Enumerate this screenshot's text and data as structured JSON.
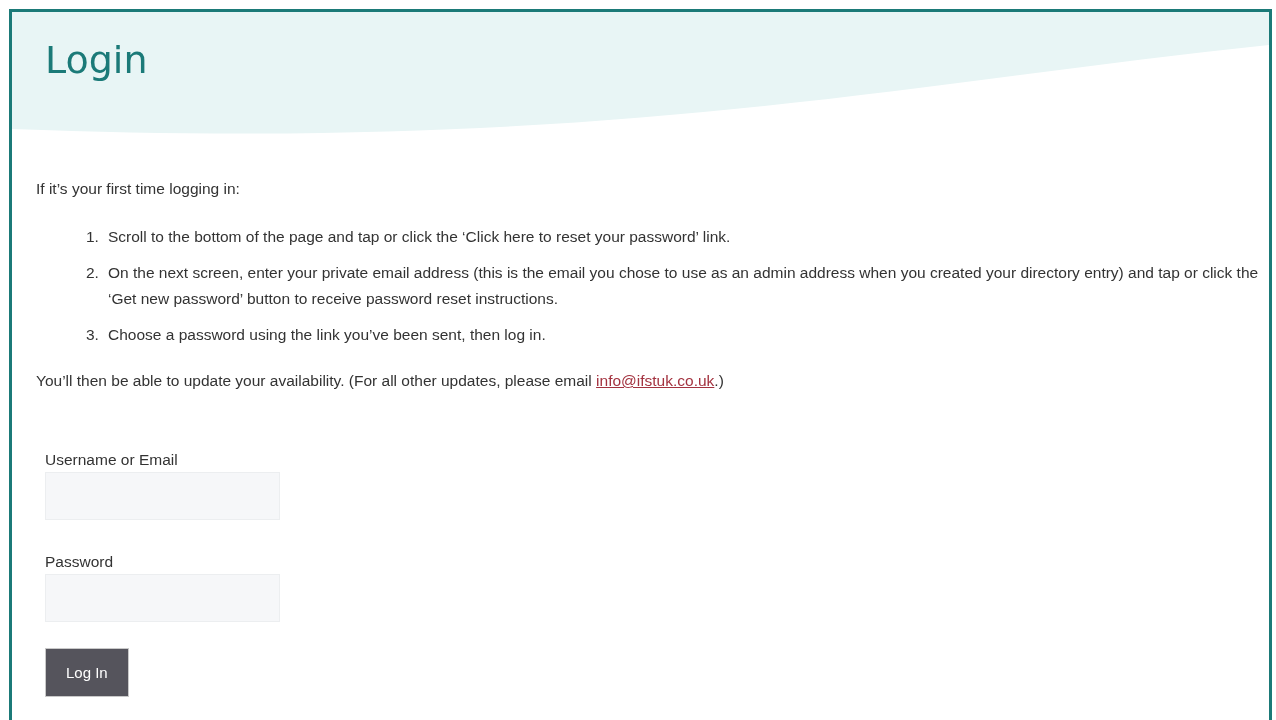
{
  "page": {
    "title": "Login"
  },
  "intro": "If it’s your first time logging in:",
  "steps": [
    {
      "number": "1.",
      "text": "Scroll to the bottom of the page and tap or click the ‘Click here to reset your password’ link."
    },
    {
      "number": "2.",
      "text": "On the next screen, enter your private email address (this is the email you chose to use as an admin address when you created your directory entry) and tap or click the ‘Get new password’ button to receive password reset instructions."
    },
    {
      "number": "3.",
      "text": "Choose a password using the link you’ve been sent, then log in."
    }
  ],
  "note": {
    "before": "You’ll then be able to update your availability. (For all other updates, please email ",
    "link": "info@ifstuk.co.uk",
    "after": ".)"
  },
  "form": {
    "fields": [
      {
        "label": "Username or Email"
      },
      {
        "label": "Password"
      }
    ],
    "submit": "Log In"
  }
}
